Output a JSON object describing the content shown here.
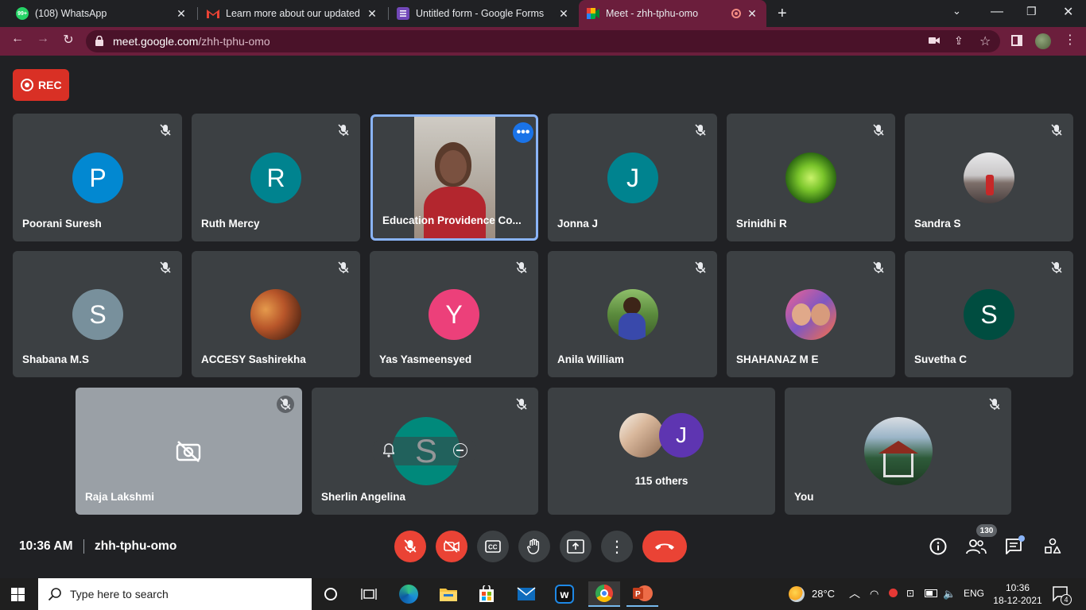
{
  "browser": {
    "tabs": [
      {
        "title": "(108) WhatsApp",
        "favicon": "whatsapp-icon",
        "color": "#25d366"
      },
      {
        "title": "Learn more about our updated Te",
        "favicon": "gmail-icon",
        "color": "#ea4335"
      },
      {
        "title": "Untitled form - Google Forms",
        "favicon": "forms-icon",
        "color": "#7248b9"
      },
      {
        "title": "Meet - zhh-tphu-omo",
        "favicon": "meet-icon",
        "color": "#00897b",
        "active": true
      }
    ],
    "url_host": "meet.google.com",
    "url_path": "/zhh-tphu-omo",
    "whatsapp_badge": "99+"
  },
  "meet": {
    "rec_label": "REC",
    "tiles": [
      {
        "name": "Poorani Suresh",
        "initial": "P",
        "color": "#0288d1"
      },
      {
        "name": "Ruth Mercy",
        "initial": "R",
        "color": "#00838f"
      },
      {
        "name": "Education Providence Co...",
        "video": true
      },
      {
        "name": "Jonna J",
        "initial": "J",
        "color": "#00838f"
      },
      {
        "name": "Srinidhi R",
        "photo": "rose-photo"
      },
      {
        "name": "Sandra S",
        "photo": "girl-photo"
      },
      {
        "name": "Shabana M.S",
        "initial": "S",
        "color": "#78909c"
      },
      {
        "name": "ACCESY Sashirekha",
        "photo": "group-photo"
      },
      {
        "name": "Yas Yasmeensyed",
        "initial": "Y",
        "color": "#ec407a"
      },
      {
        "name": "Anila William",
        "photo": "anila-photo"
      },
      {
        "name": "SHAHANAZ M E",
        "photo": "kids-photo"
      },
      {
        "name": "Suvetha C",
        "initial": "S",
        "color": "#004d40"
      },
      {
        "name": "Raja Lakshmi",
        "camera_off": true
      },
      {
        "name": "Sherlin Angelina",
        "initial": "S",
        "color": "#00897b"
      },
      {
        "name": "115 others",
        "others": true,
        "initial": "J",
        "color": "#5e35b1"
      },
      {
        "name": "You",
        "photo": "gazebo-photo"
      }
    ],
    "time": "10:36 AM",
    "meeting_code": "zhh-tphu-omo",
    "participants_count": "130"
  },
  "taskbar": {
    "search_placeholder": "Type here to search",
    "weather": "28°C",
    "language": "ENG",
    "time": "10:36",
    "date": "18-12-2021",
    "notifications": "4"
  }
}
